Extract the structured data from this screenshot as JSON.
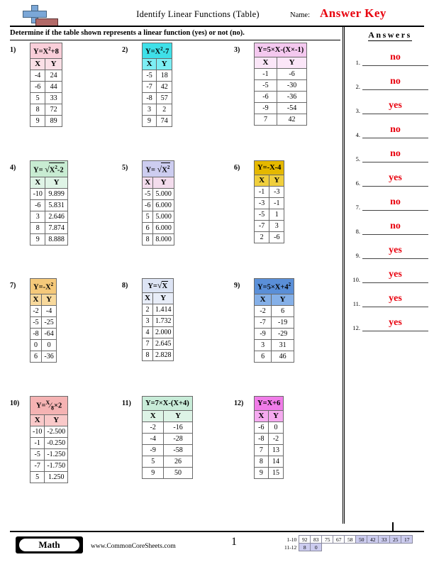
{
  "header": {
    "title": "Identify Linear Functions (Table)",
    "name_label": "Name:",
    "answer_key": "Answer Key",
    "logo_icon": "plus-book-icon"
  },
  "directions": "Determine if the table shown represents a linear function (yes) or not (no).",
  "answers_panel": {
    "title": "Answers",
    "items": [
      {
        "num": "1.",
        "value": "no"
      },
      {
        "num": "2.",
        "value": "no"
      },
      {
        "num": "3.",
        "value": "yes"
      },
      {
        "num": "4.",
        "value": "no"
      },
      {
        "num": "5.",
        "value": "no"
      },
      {
        "num": "6.",
        "value": "yes"
      },
      {
        "num": "7.",
        "value": "no"
      },
      {
        "num": "8.",
        "value": "no"
      },
      {
        "num": "9.",
        "value": "yes"
      },
      {
        "num": "10.",
        "value": "yes"
      },
      {
        "num": "11.",
        "value": "yes"
      },
      {
        "num": "12.",
        "value": "yes"
      }
    ],
    "answer_color": "#e8000d"
  },
  "columns": {
    "x": "X",
    "y": "Y"
  },
  "problems": [
    {
      "num": "1)",
      "equation_plain": "Y=X²+8",
      "title_bg": "#f9ced9",
      "header_bg": "#fadfe6",
      "rows": [
        {
          "x": "-4",
          "y": "24"
        },
        {
          "x": "-6",
          "y": "44"
        },
        {
          "x": "5",
          "y": "33"
        },
        {
          "x": "8",
          "y": "72"
        },
        {
          "x": "9",
          "y": "89"
        }
      ]
    },
    {
      "num": "2)",
      "equation_plain": "Y=X²-7",
      "title_bg": "#3fe0e8",
      "header_bg": "#7ceef4",
      "rows": [
        {
          "x": "-5",
          "y": "18"
        },
        {
          "x": "-7",
          "y": "42"
        },
        {
          "x": "-8",
          "y": "57"
        },
        {
          "x": "3",
          "y": "2"
        },
        {
          "x": "9",
          "y": "74"
        }
      ]
    },
    {
      "num": "3)",
      "equation_plain": "Y=5×X-(X×-1)",
      "title_bg": "#f4c8ef",
      "header_bg": "#fbe6f8",
      "rows": [
        {
          "x": "-1",
          "y": "-6"
        },
        {
          "x": "-5",
          "y": "-30"
        },
        {
          "x": "-6",
          "y": "-36"
        },
        {
          "x": "-9",
          "y": "-54"
        },
        {
          "x": "7",
          "y": "42"
        }
      ]
    },
    {
      "num": "4)",
      "equation_plain": "Y= √(X²-2)",
      "title_bg": "#c8ecd2",
      "header_bg": "#dff4e6",
      "rows": [
        {
          "x": "-10",
          "y": "9.899"
        },
        {
          "x": "-6",
          "y": "5.831"
        },
        {
          "x": "3",
          "y": "2.646"
        },
        {
          "x": "8",
          "y": "7.874"
        },
        {
          "x": "9",
          "y": "8.888"
        }
      ]
    },
    {
      "num": "5)",
      "equation_plain": "Y= √(X²)",
      "title_bg": "#cdcdf0",
      "header_bg": "#f3dced",
      "rows": [
        {
          "x": "-5",
          "y": "5.000"
        },
        {
          "x": "-6",
          "y": "6.000"
        },
        {
          "x": "5",
          "y": "5.000"
        },
        {
          "x": "6",
          "y": "6.000"
        },
        {
          "x": "8",
          "y": "8.000"
        }
      ]
    },
    {
      "num": "6)",
      "equation_plain": "Y=-X-4",
      "title_bg": "#e5b800",
      "header_bg": "#f0cf3d",
      "rows": [
        {
          "x": "-1",
          "y": "-3"
        },
        {
          "x": "-3",
          "y": "-1"
        },
        {
          "x": "-5",
          "y": "1"
        },
        {
          "x": "-7",
          "y": "3"
        },
        {
          "x": "2",
          "y": "-6"
        }
      ]
    },
    {
      "num": "7)",
      "equation_plain": "Y=-X²",
      "title_bg": "#f5c97a",
      "header_bg": "#f8d99c",
      "rows": [
        {
          "x": "-2",
          "y": "-4"
        },
        {
          "x": "-5",
          "y": "-25"
        },
        {
          "x": "-8",
          "y": "-64"
        },
        {
          "x": "0",
          "y": "0"
        },
        {
          "x": "6",
          "y": "-36"
        }
      ]
    },
    {
      "num": "8)",
      "equation_plain": "Y=√X",
      "title_bg": "#dde4f4",
      "header_bg": "#e8edf8",
      "rows": [
        {
          "x": "2",
          "y": "1.414"
        },
        {
          "x": "3",
          "y": "1.732"
        },
        {
          "x": "4",
          "y": "2.000"
        },
        {
          "x": "7",
          "y": "2.645"
        },
        {
          "x": "8",
          "y": "2.828"
        }
      ]
    },
    {
      "num": "9)",
      "equation_plain": "Y=5×X+4²",
      "title_bg": "#5a8fd8",
      "header_bg": "#85b0e8",
      "rows": [
        {
          "x": "-2",
          "y": "6"
        },
        {
          "x": "-7",
          "y": "-19"
        },
        {
          "x": "-9",
          "y": "-29"
        },
        {
          "x": "3",
          "y": "31"
        },
        {
          "x": "6",
          "y": "46"
        }
      ]
    },
    {
      "num": "10)",
      "equation_plain": "Y= X/8×2",
      "title_bg": "#f5b3b3",
      "header_bg": "#f9c9c9",
      "rows": [
        {
          "x": "-10",
          "y": "-2.500"
        },
        {
          "x": "-1",
          "y": "-0.250"
        },
        {
          "x": "-5",
          "y": "-1.250"
        },
        {
          "x": "-7",
          "y": "-1.750"
        },
        {
          "x": "5",
          "y": "1.250"
        }
      ]
    },
    {
      "num": "11)",
      "equation_plain": "Y=7×X-(X+4)",
      "title_bg": "#c8ecd8",
      "header_bg": "#ddf3e6",
      "rows": [
        {
          "x": "-2",
          "y": "-16"
        },
        {
          "x": "-4",
          "y": "-28"
        },
        {
          "x": "-9",
          "y": "-58"
        },
        {
          "x": "5",
          "y": "26"
        },
        {
          "x": "9",
          "y": "50"
        }
      ]
    },
    {
      "num": "12)",
      "equation_plain": "Y=X+6",
      "title_bg": "#f07ce8",
      "header_bg": "#f5aaf0",
      "rows": [
        {
          "x": "-6",
          "y": "0"
        },
        {
          "x": "-8",
          "y": "-2"
        },
        {
          "x": "7",
          "y": "13"
        },
        {
          "x": "8",
          "y": "14"
        },
        {
          "x": "9",
          "y": "15"
        }
      ]
    }
  ],
  "footer": {
    "badge": "Math",
    "site": "www.CommonCoreSheets.com",
    "page_number": "1",
    "scale": {
      "row1_label": "1-10",
      "row2_label": "11-12",
      "row1": [
        {
          "v": "92",
          "hl": false
        },
        {
          "v": "83",
          "hl": false
        },
        {
          "v": "75",
          "hl": false
        },
        {
          "v": "67",
          "hl": false
        },
        {
          "v": "58",
          "hl": false
        },
        {
          "v": "50",
          "hl": true
        },
        {
          "v": "42",
          "hl": true
        },
        {
          "v": "33",
          "hl": true
        },
        {
          "v": "25",
          "hl": true
        },
        {
          "v": "17",
          "hl": true
        }
      ],
      "row2": [
        {
          "v": "8",
          "hl": true
        },
        {
          "v": "0",
          "hl": true
        }
      ]
    }
  }
}
